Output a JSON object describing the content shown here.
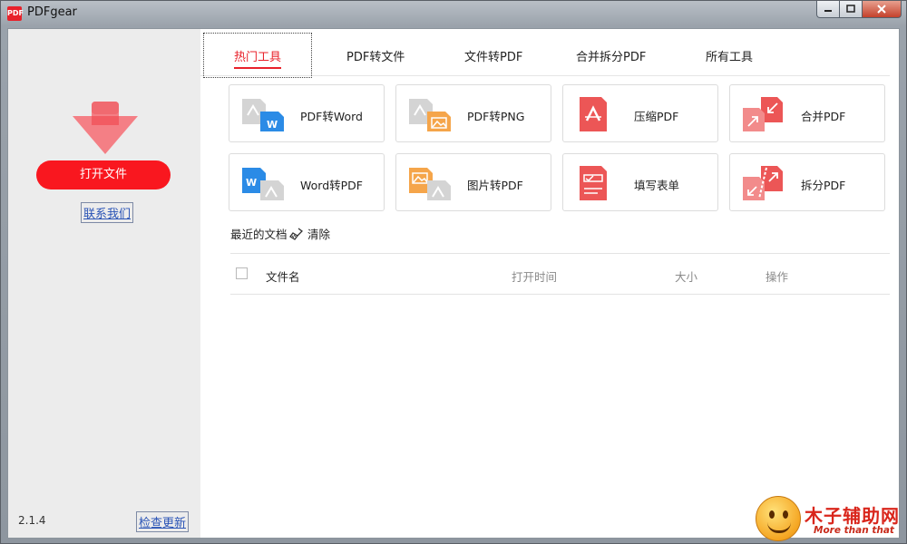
{
  "window": {
    "title": "PDFgear",
    "logo_text": "PDF"
  },
  "colors": {
    "accent": "#e8212a",
    "blue": "#2b8be6",
    "orange": "#f5a54a",
    "red": "#ec5656",
    "gray": "#cfcfcf"
  },
  "sidebar": {
    "open_button": "打开文件",
    "contact_link": "联系我们",
    "version": "2.1.4",
    "update_link": "检查更新"
  },
  "tabs": [
    {
      "label": "热门工具",
      "active": true
    },
    {
      "label": "PDF转文件"
    },
    {
      "label": "文件转PDF"
    },
    {
      "label": "合并拆分PDF"
    },
    {
      "label": "所有工具"
    }
  ],
  "tools": [
    {
      "label": "PDF转Word",
      "icon": "pdf-to-word-icon"
    },
    {
      "label": "PDF转PNG",
      "icon": "pdf-to-png-icon"
    },
    {
      "label": "压缩PDF",
      "icon": "compress-pdf-icon"
    },
    {
      "label": "合并PDF",
      "icon": "merge-pdf-icon"
    },
    {
      "label": "Word转PDF",
      "icon": "word-to-pdf-icon"
    },
    {
      "label": "图片转PDF",
      "icon": "image-to-pdf-icon"
    },
    {
      "label": "填写表单",
      "icon": "fill-form-icon"
    },
    {
      "label": "拆分PDF",
      "icon": "split-pdf-icon"
    }
  ],
  "recent": {
    "title": "最近的文档",
    "clear_label": "清除",
    "columns": {
      "name": "文件名",
      "time": "打开时间",
      "size": "大小",
      "ops": "操作"
    }
  },
  "watermark": {
    "text": "木子辅助网",
    "sub": "More than that"
  }
}
